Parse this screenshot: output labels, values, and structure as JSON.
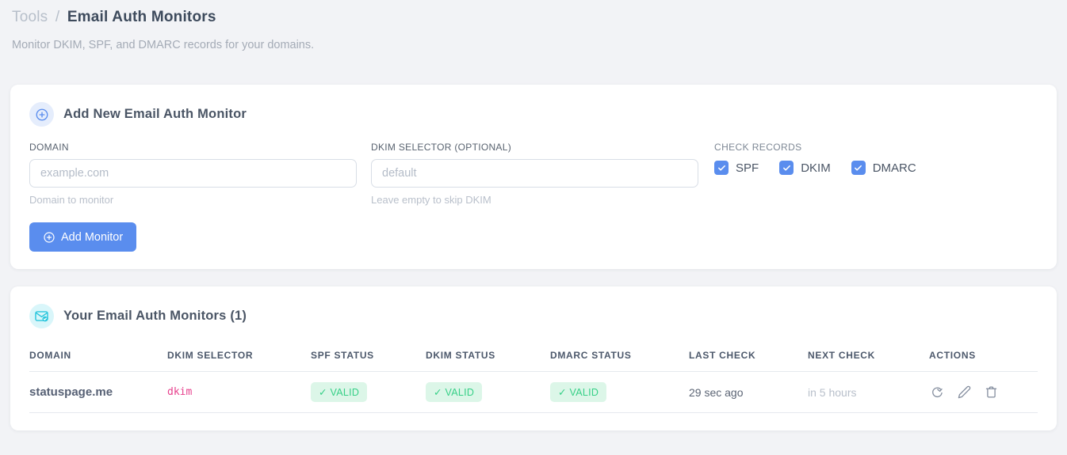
{
  "breadcrumb": {
    "section": "Tools",
    "separator": "/",
    "page": "Email Auth Monitors"
  },
  "subtitle": "Monitor DKIM, SPF, and DMARC records for your domains.",
  "add_card": {
    "title": "Add New Email Auth Monitor",
    "domain_field": {
      "label": "DOMAIN",
      "placeholder": "example.com",
      "helper": "Domain to monitor"
    },
    "dkim_field": {
      "label": "DKIM SELECTOR (OPTIONAL)",
      "placeholder": "default",
      "helper": "Leave empty to skip DKIM"
    },
    "check_records": {
      "label": "CHECK RECORDS",
      "options": [
        {
          "label": "SPF",
          "checked": true
        },
        {
          "label": "DKIM",
          "checked": true
        },
        {
          "label": "DMARC",
          "checked": true
        }
      ]
    },
    "submit_label": "Add Monitor"
  },
  "monitors_card": {
    "title": "Your Email Auth Monitors (1)",
    "table": {
      "headers": [
        "DOMAIN",
        "DKIM SELECTOR",
        "SPF STATUS",
        "DKIM STATUS",
        "DMARC STATUS",
        "LAST CHECK",
        "NEXT CHECK",
        "ACTIONS"
      ],
      "rows": [
        {
          "domain": "statuspage.me",
          "dkim_selector": "dkim",
          "spf_status": "✓ VALID",
          "dkim_status": "✓ VALID",
          "dmarc_status": "✓ VALID",
          "last_check": "29 sec ago",
          "next_check": "in 5 hours"
        }
      ]
    }
  },
  "icons": {
    "add_card_icon": "circle-plus-icon",
    "monitors_card_icon": "email-check-icon",
    "actions": [
      "refresh-icon",
      "edit-pencil-icon",
      "trash-icon"
    ]
  },
  "colors": {
    "accent_blue": "#5a8dee",
    "accent_cyan": "#28c5dc",
    "valid_badge_bg": "#dcf6e8",
    "valid_badge_text": "#36d087",
    "selector_pink": "#e7418d",
    "page_bg": "#f2f3f6"
  }
}
